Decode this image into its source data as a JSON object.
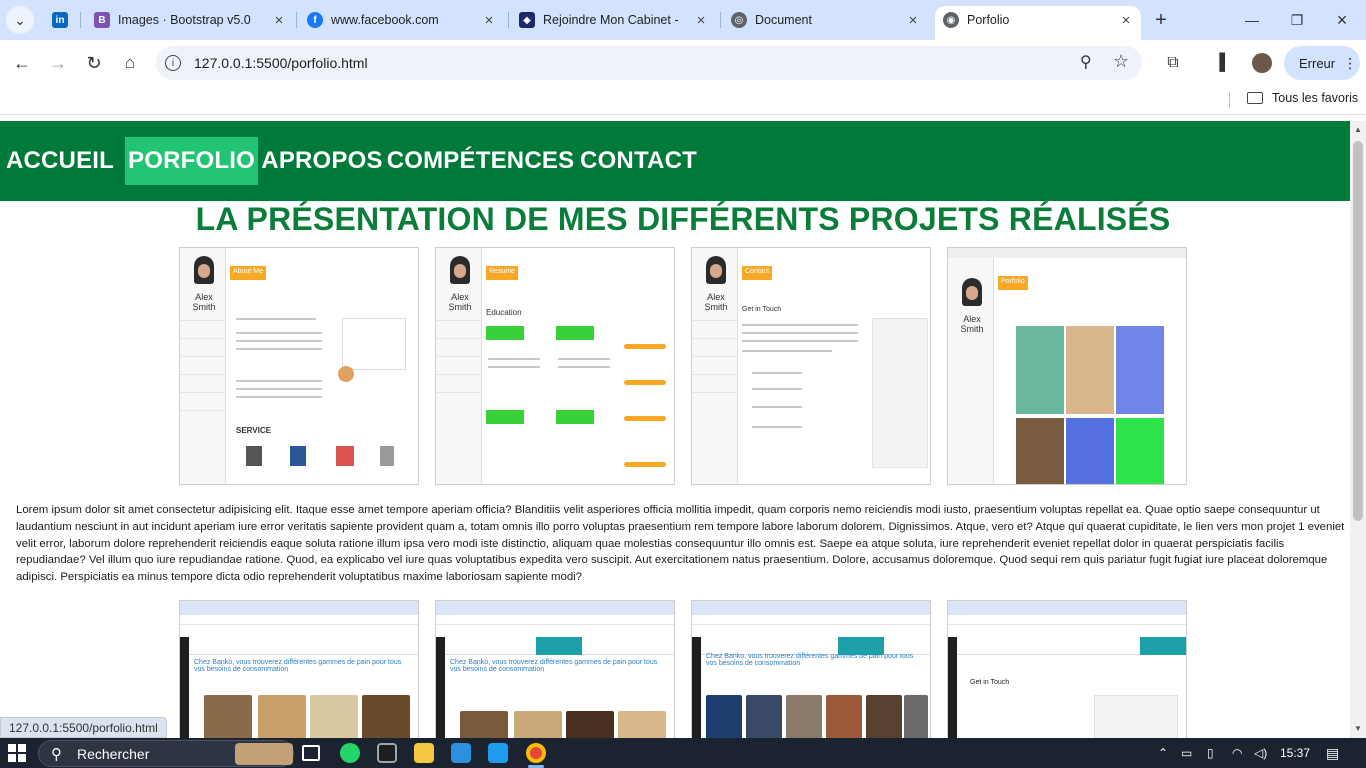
{
  "browser": {
    "tabs": [
      {
        "title": "",
        "icon": "linkedin-icon",
        "color": "#0a66c2"
      },
      {
        "title": "Images · Bootstrap v5.0",
        "icon": "bootstrap-icon",
        "color": "#7952b3"
      },
      {
        "title": "www.facebook.com",
        "icon": "facebook-icon",
        "color": "#1877f2"
      },
      {
        "title": "Rejoindre Mon Cabinet - D",
        "icon": "cabinet-icon",
        "color": "#1c2a6b"
      },
      {
        "title": "Document",
        "icon": "globe-icon",
        "color": "#5f6368"
      },
      {
        "title": "Porfolio",
        "icon": "broadcast-icon",
        "color": "#5f6368"
      }
    ],
    "url": "127.0.0.1:5500/porfolio.html",
    "profile_label": "Erreur",
    "bookmarks_label": "Tous les favoris"
  },
  "page": {
    "nav": [
      "ACCUEIL",
      "PORFOLIO",
      "APROPOS",
      "COMPÉTENCES",
      "CONTACT"
    ],
    "active_nav": "PORFOLIO",
    "heading": "LA PRÉSENTATION DE MES DIFFÉRENTS PROJETS RÉALISÉS",
    "project_shots_row1": [
      {
        "section": "About Me",
        "name": "Alex Smith",
        "subtitle": "SERVICE"
      },
      {
        "section": "Resume",
        "name": "Alex Smith",
        "subtitle": "Education"
      },
      {
        "section": "Contact",
        "name": "Alex Smith",
        "subtitle": "Get in Touch"
      },
      {
        "section": "Porfolio",
        "name": "Alex Smith",
        "subtitle": ""
      }
    ],
    "paragraph": "Lorem ipsum dolor sit amet consectetur adipisicing elit. Itaque esse amet tempore aperiam officia? Blanditiis velit asperiores officia mollitia impedit, quam corporis nemo reiciendis modi iusto, praesentium voluptas repellat ea. Quae optio saepe consequuntur ut laudantium nesciunt in aut incidunt aperiam iure error veritatis sapiente provident quam a, totam omnis illo porro voluptas praesentium rem tempore labore laborum dolorem. Dignissimos. Atque, vero et? Atque qui quaerat cupiditate, le lien vers mon projet 1 eveniet velit error, laborum dolore reprehenderit reiciendis eaque soluta ratione illum ipsa vero modi iste distinctio, aliquam quae molestias consequuntur illo omnis est. Saepe ea atque soluta, iure reprehenderit eveniet repellat dolor in quaerat perspiciatis facilis repudiandae? Vel illum quo iure repudiandae ratione. Quod, ea explicabo vel iure quas voluptatibus expedita vero suscipit. Aut exercitationem natus praesentium. Dolore, accusamus doloremque. Quod sequi rem quis pariatur fugit fugiat iure placeat doloremque adipisci. Perspiciatis ea minus tempore dicta odio reprehenderit voluptatibus maxime laboriosam sapiente modi?",
    "project_shots_row2": [
      {
        "title": "Chez Banko, vous trouverez différentes gammes de pain pour tous vos besoins de consommation"
      },
      {
        "title": "Chez Banko, vous trouverez différentes gammes de pain pour tous vos besoins de consommation"
      },
      {
        "title": "Chez Banko, vous trouverez différentes gammes de pain pour tous vos besoins de consommation"
      },
      {
        "title": "Get in Touch"
      }
    ]
  },
  "status_url": "127.0.0.1:5500/porfolio.html",
  "taskbar": {
    "search_placeholder": "Rechercher",
    "time": "15:37"
  }
}
